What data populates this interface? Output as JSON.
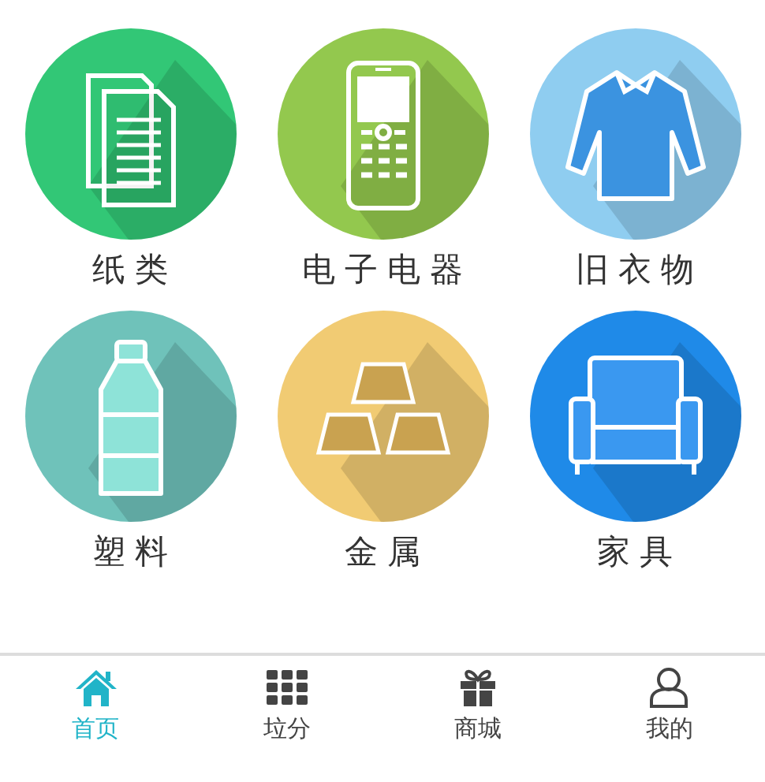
{
  "categories": [
    {
      "label": "纸类",
      "kind": "papers",
      "color": "#32c776"
    },
    {
      "label": "电子电器",
      "kind": "phone",
      "color": "#93c84e"
    },
    {
      "label": "旧衣物",
      "kind": "shirt",
      "color": "#8fcdf0"
    },
    {
      "label": "塑料",
      "kind": "bottle",
      "color": "#6fc2ba"
    },
    {
      "label": "金属",
      "kind": "gold",
      "color": "#f1cb73"
    },
    {
      "label": "家具",
      "kind": "sofa",
      "color": "#1f8ae8"
    }
  ],
  "nav": [
    {
      "label": "首页",
      "kind": "home",
      "selected": true
    },
    {
      "label": "垃分",
      "kind": "grid",
      "selected": false
    },
    {
      "label": "商城",
      "kind": "gift",
      "selected": false
    },
    {
      "label": "我的",
      "kind": "user",
      "selected": false
    }
  ]
}
